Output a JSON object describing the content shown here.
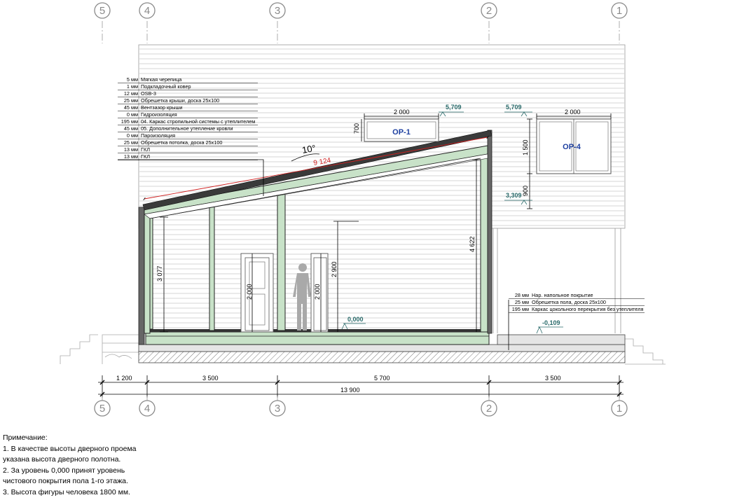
{
  "axes": [
    "5",
    "4",
    "3",
    "2",
    "1"
  ],
  "roof_layers": [
    {
      "t": "5 мм",
      "name": "Мягкая черепица"
    },
    {
      "t": "1 мм",
      "name": "Подкладочный ковер"
    },
    {
      "t": "12 мм",
      "name": "OSB-3"
    },
    {
      "t": "25 мм",
      "name": "Обрешетка крыши, доска 25х100"
    },
    {
      "t": "45 мм",
      "name": "Вентзазор крыши"
    },
    {
      "t": "0 мм",
      "name": "Гидроизоляция"
    },
    {
      "t": "195 мм",
      "name": "04. Каркас стропильной системы с утеплителем"
    },
    {
      "t": "45 мм",
      "name": "05. Дополнительное утепление кровли"
    },
    {
      "t": "0 мм",
      "name": "Пароизоляция"
    },
    {
      "t": "25 мм",
      "name": "Обрешетка потолка, доска 25х100"
    },
    {
      "t": "13 мм",
      "name": "ГКЛ"
    },
    {
      "t": "13 мм",
      "name": "ГКЛ"
    }
  ],
  "floor_layers": [
    {
      "t": "28 мм",
      "name": "Нар. напольное покрытие"
    },
    {
      "t": "25 мм",
      "name": "Обрешетка пола, доска 25х100"
    },
    {
      "t": "195 мм",
      "name": "Каркас цокольного перекрытия без утеплителя"
    }
  ],
  "windows": {
    "op1": {
      "label": "ОР-1",
      "width": "2 000",
      "height": "700",
      "level": "5,709"
    },
    "op4": {
      "label": "ОР-4",
      "width": "2 000",
      "height": "1 500",
      "sill": "900",
      "level_top": "5,709",
      "level_bottom": "3,309"
    }
  },
  "dims": {
    "roof_angle": "10°",
    "roof_length": "9 124",
    "h_left": "3 077",
    "h_right": "4 622",
    "door_left": "2 000",
    "door_right": "2 000",
    "figure_h": "2 900",
    "level_floor": "0,000",
    "level_outside": "-0,109",
    "span_1": "1 200",
    "span_2": "3 500",
    "span_3": "5 700",
    "span_4": "3 500",
    "total": "13 900"
  },
  "notes": {
    "title": "Примечание:",
    "lines": [
      "1. В качестве высоты дверного проема",
      "указана высота дверного полотна.",
      "2. За уровень 0,000 принят уровень",
      "чистового покрытия пола 1-го этажа.",
      "3. Высота фигуры человека 1800 мм."
    ]
  },
  "colors": {
    "frame": "#c8e2c8",
    "roof_dim": "#d02020",
    "level": "#2a6b6b",
    "window_label": "#1d3fa0",
    "axis": "#8a8a8a"
  }
}
